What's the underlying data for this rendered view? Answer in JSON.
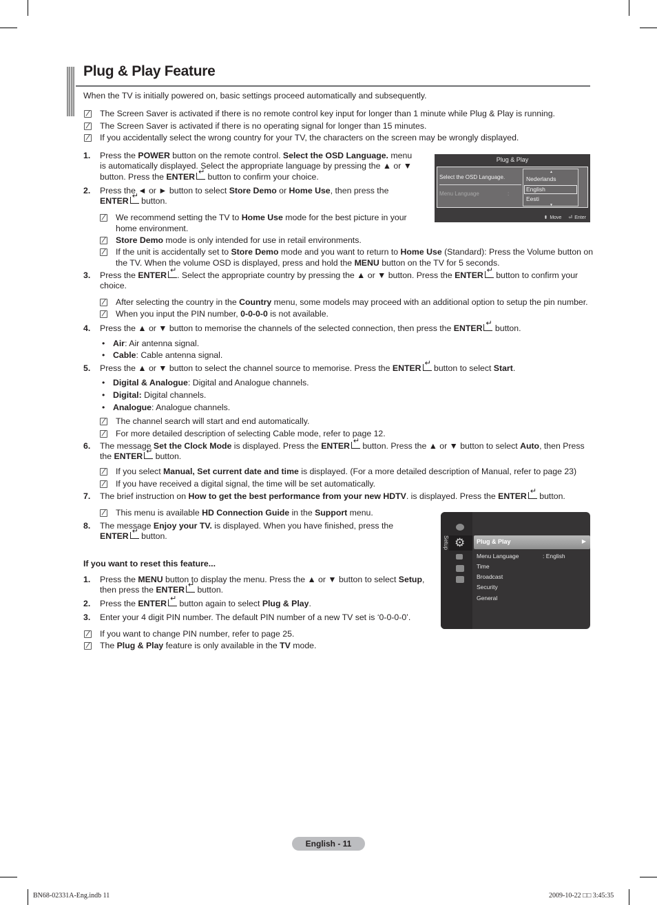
{
  "header": {
    "title": "Plug & Play Feature",
    "intro": "When the TV is initially powered on, basic settings proceed automatically and  subsequently."
  },
  "top_notes": [
    "The Screen Saver is activated if there is no remote control key input for longer than 1 minute while Plug & Play is running.",
    "The Screen Saver is activated if there is no operating signal for longer than 15 minutes.",
    "If you accidentally select the wrong country for your TV, the characters on the screen may be wrongly displayed."
  ],
  "steps": {
    "s1": {
      "num": "1.",
      "l1a": "Press the ",
      "l1b": "POWER",
      "l1c": " button on the remote control. ",
      "l1d": "Select the OSD Language.",
      "l1e": " menu",
      "l2": "is automatically displayed. Select the appropriate language by pressing the ▲ or ▼",
      "l3a": "button. Press the ",
      "l3b": "ENTER",
      "l3c": " button to confirm your choice."
    },
    "s2": {
      "num": "2.",
      "l1a": "Press the ◄ or ► button to select ",
      "l1b": "Store Demo",
      "l1c": " or ",
      "l1d": "Home Use",
      "l1e": ", then press the",
      "l2a": "ENTER",
      "l2b": " button.",
      "n1a": "We recommend setting the TV to ",
      "n1b": "Home Use",
      "n1c": " mode for the best picture in your",
      "n1d": "home environment.",
      "n2a": "Store Demo",
      "n2b": " mode is only intended for use in retail environments.",
      "n3a": "If the unit is accidentally set to ",
      "n3b": "Store Demo",
      "n3c": " mode and you want to return to ",
      "n3d": "Home Use",
      "n3e": " (Standard): Press the Volume button on",
      "n3f": "the TV. When the volume OSD is displayed, press and hold the ",
      "n3g": "MENU",
      "n3h": " button on the TV for 5 seconds."
    },
    "s3": {
      "num": "3.",
      "l1a": "Press the ",
      "l1b": "ENTER",
      "l1c": ". Select the appropriate country by pressing the ▲ or ▼ button. Press the ",
      "l1d": "ENTER",
      "l1e": " button to confirm your",
      "l2": "choice.",
      "n1a": "After selecting the country in the ",
      "n1b": "Country",
      "n1c": " menu, some models may proceed with an additional option to setup the pin number.",
      "n2a": "When you input the PIN number, ",
      "n2b": "0-0-0-0",
      "n2c": " is not available."
    },
    "s4": {
      "num": "4.",
      "l1a": "Press the ▲ or ▼ button to memorise the channels of the selected connection, then press the ",
      "l1b": "ENTER",
      "l1c": " button.",
      "b1a": "Air",
      "b1b": ": Air antenna signal.",
      "b2a": "Cable",
      "b2b": ": Cable antenna signal."
    },
    "s5": {
      "num": "5.",
      "l1a": "Press the ▲ or ▼ button to select the channel source to memorise. Press the ",
      "l1b": "ENTER",
      "l1c": " button to select ",
      "l1d": "Start",
      "l1e": ".",
      "b1a": "Digital & Analogue",
      "b1b": ": Digital and Analogue channels.",
      "b2a": "Digital:",
      "b2b": " Digital channels.",
      "b3a": "Analogue",
      "b3b": ": Analogue channels.",
      "n1": "The channel search will start and end automatically.",
      "n2": "For more detailed description of selecting Cable mode, refer to page 12."
    },
    "s6": {
      "num": "6.",
      "l1a": "The message ",
      "l1b": "Set the Clock Mode",
      "l1c": " is displayed. Press the ",
      "l1d": "ENTER",
      "l1e": " button. Press the ▲ or ▼ button to select ",
      "l1f": "Auto",
      "l1g": ", then Press",
      "l2a": "the ",
      "l2b": "ENTER",
      "l2c": " button.",
      "n1a": "If you select ",
      "n1b": "Manual, Set current date and time",
      "n1c": " is displayed. (For a more detailed description of Manual, refer to page 23)",
      "n2": "If you have received a digital signal, the time will be set automatically."
    },
    "s7": {
      "num": "7.",
      "l1a": "The brief instruction on ",
      "l1b": "How to get the best performance from your new HDTV",
      "l1c": ". is displayed. Press the ",
      "l1d": "ENTER",
      "l1e": " button.",
      "n1a": "This menu is available ",
      "n1b": "HD Connection Guide",
      "n1c": " in the ",
      "n1d": "Support",
      "n1e": " menu."
    },
    "s8": {
      "num": "8.",
      "l1a": "The message ",
      "l1b": "Enjoy your TV.",
      "l1c": " is displayed. When you have finished, press the",
      "l2a": "ENTER",
      "l2b": " button."
    }
  },
  "reset": {
    "heading": "If you want to reset this feature...",
    "r1": {
      "num": "1.",
      "l1a": "Press the ",
      "l1b": "MENU",
      "l1c": " button to display the menu. Press the ▲ or ▼ button to select ",
      "l1d": "Setup",
      "l1e": ",",
      "l2a": "then press the ",
      "l2b": "ENTER",
      "l2c": " button."
    },
    "r2": {
      "num": "2.",
      "l1a": "Press the ",
      "l1b": "ENTER",
      "l1c": " button again to select ",
      "l1d": "Plug & Play",
      "l1e": "."
    },
    "r3": {
      "num": "3.",
      "l1": "Enter your 4 digit PIN number. The default PIN number of a new TV set is ‘0-0-0-0’."
    },
    "n1": "If you want to change PIN number, refer to page 25.",
    "n2a": "The ",
    "n2b": "Plug & Play",
    "n2c": " feature is only available in the ",
    "n2d": "TV",
    "n2e": " mode."
  },
  "osd_language": {
    "title": "Plug & Play",
    "prompt": "Select the OSD Language.",
    "field_label": "Menu Language",
    "colon": ":",
    "options": [
      "Nederlands",
      "English",
      "Eesti"
    ],
    "selected": "English",
    "footer_move": "Move",
    "footer_enter": "Enter"
  },
  "osd_setup": {
    "side_label": "Setup",
    "highlighted": "Plug & Play",
    "items": [
      {
        "label": "Menu Language",
        "value": ": English"
      },
      {
        "label": "Time",
        "value": ""
      },
      {
        "label": "Broadcast",
        "value": ""
      },
      {
        "label": "Security",
        "value": ""
      },
      {
        "label": "General",
        "value": ""
      }
    ]
  },
  "footer": {
    "page": "English - 11",
    "file": "BN68-02331A-Eng.indb   11",
    "timestamp": "2009-10-22   □□ 3:45:35"
  }
}
